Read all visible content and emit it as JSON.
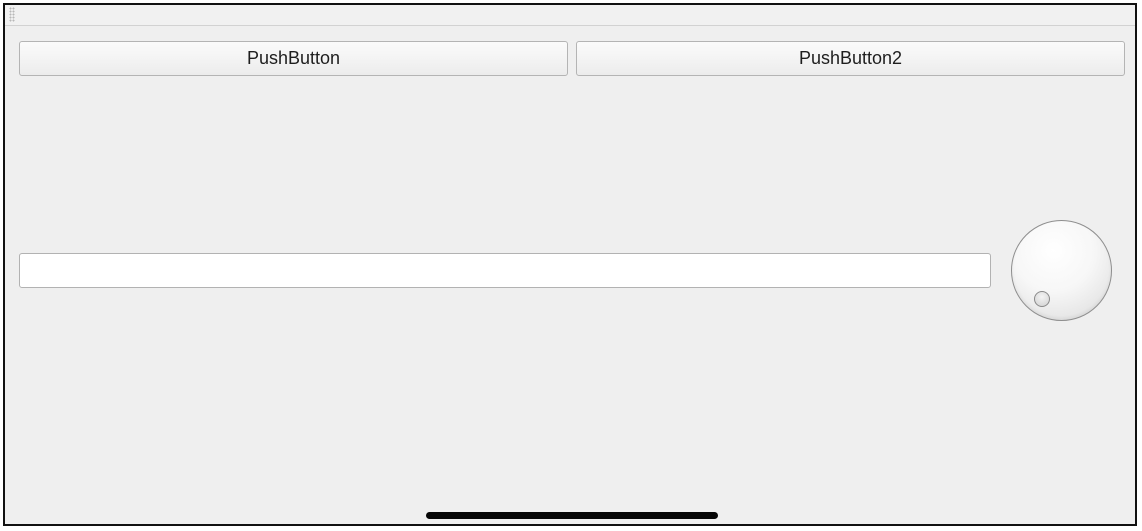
{
  "toolbar": {
    "grip_icon": "grip-handle-icon"
  },
  "buttons": {
    "push_button_1": "PushButton",
    "push_button_2": "PushButton2"
  },
  "line_edit": {
    "value": "",
    "placeholder": ""
  },
  "dial": {
    "icon": "dial-knob-icon"
  },
  "colors": {
    "window_background": "#efefef",
    "border": "#111111",
    "home_indicator": "#050505"
  }
}
